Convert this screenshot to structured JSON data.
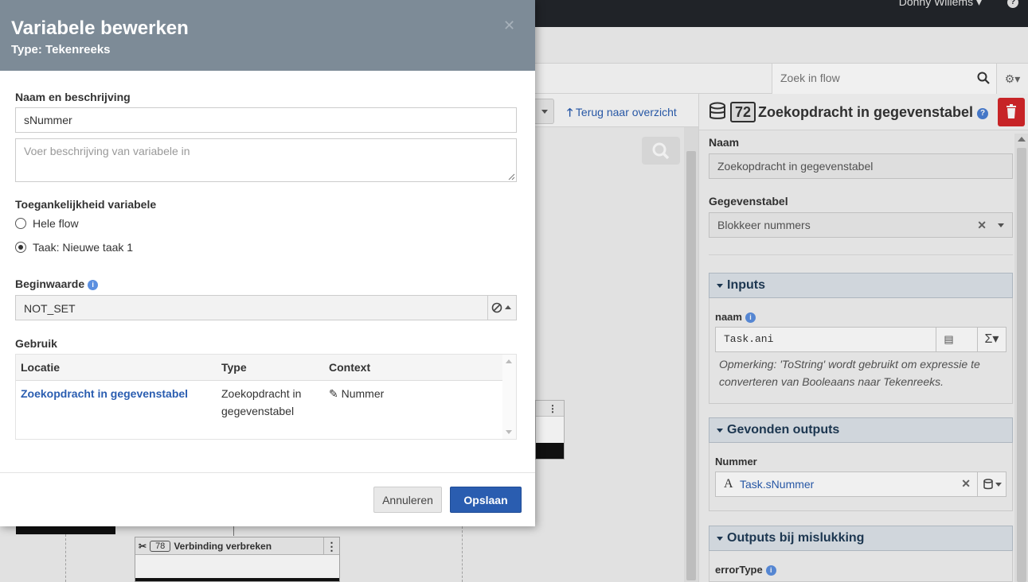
{
  "topbar": {
    "user": "Donny Willems",
    "help": "?"
  },
  "search": {
    "placeholder": "Zoek in flow"
  },
  "canvas": {
    "back_link": "Terug naar overzicht",
    "node_78": {
      "number": "78",
      "label": "Verbinding verbreken"
    }
  },
  "panel": {
    "number": "72",
    "title": "Zoekopdracht in gegevenstabel",
    "naam_label": "Naam",
    "naam_value": "Zoekopdracht in gegevenstabel",
    "gegevenstabel_label": "Gegevenstabel",
    "gegevenstabel_value": "Blokkeer nummers",
    "inputs": {
      "title": "Inputs",
      "field_label": "naam",
      "expression": "Task.ani",
      "note": "Opmerking: 'ToString' wordt gebruikt om expressie te converteren van Booleaans naar Tekenreeks."
    },
    "found_outputs": {
      "title": "Gevonden outputs",
      "field_label": "Nummer",
      "value": "Task.sNummer"
    },
    "failure_outputs": {
      "title": "Outputs bij mislukking",
      "field_label": "errorType"
    }
  },
  "modal": {
    "title": "Variabele bewerken",
    "subtitle": "Type: Tekenreeks",
    "name_section_label": "Naam en beschrijving",
    "name_value": "sNummer",
    "description_placeholder": "Voer beschrijving van variabele in",
    "access_label": "Toegankelijkheid variabele",
    "access_options": [
      "Hele flow",
      "Taak: Nieuwe taak 1"
    ],
    "access_selected": 1,
    "initial_label": "Beginwaarde",
    "initial_value": "NOT_SET",
    "usage_label": "Gebruik",
    "usage_columns": [
      "Locatie",
      "Type",
      "Context"
    ],
    "usage_rows": [
      {
        "locatie": "Zoekopdracht in gegevenstabel",
        "type_line1": "Zoekopdracht in",
        "type_line2": "gegevenstabel",
        "context": "Nummer"
      }
    ],
    "cancel_label": "Annuleren",
    "save_label": "Opslaan"
  },
  "colors": {
    "modal_header": "#7d8b97",
    "primary_button": "#2a5db0",
    "delete_button": "#d4272a",
    "section_header": "#dde4ea"
  }
}
